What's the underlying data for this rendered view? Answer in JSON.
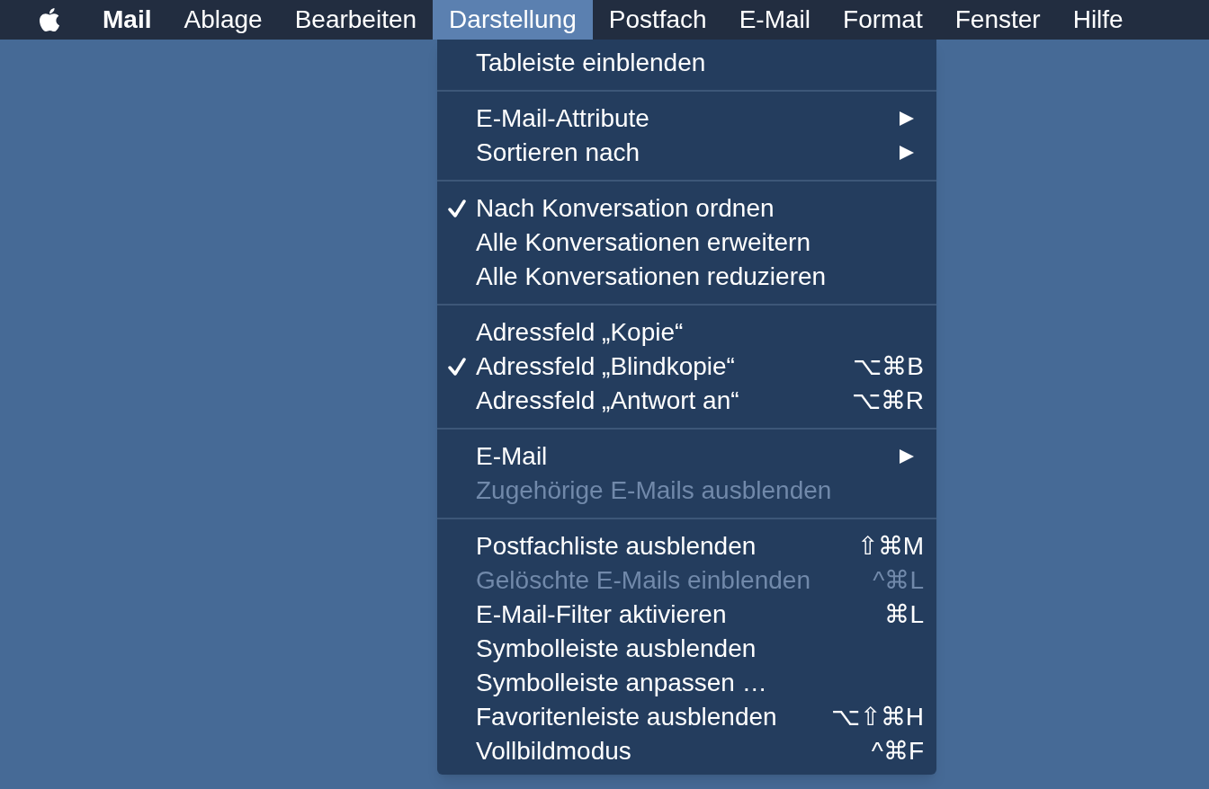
{
  "menu_bar": {
    "items": [
      {
        "label": "Mail",
        "bold": true,
        "selected": false
      },
      {
        "label": "Ablage",
        "bold": false,
        "selected": false
      },
      {
        "label": "Bearbeiten",
        "bold": false,
        "selected": false
      },
      {
        "label": "Darstellung",
        "bold": false,
        "selected": true
      },
      {
        "label": "Postfach",
        "bold": false,
        "selected": false
      },
      {
        "label": "E-Mail",
        "bold": false,
        "selected": false
      },
      {
        "label": "Format",
        "bold": false,
        "selected": false
      },
      {
        "label": "Fenster",
        "bold": false,
        "selected": false
      },
      {
        "label": "Hilfe",
        "bold": false,
        "selected": false
      }
    ]
  },
  "menu": {
    "groups": [
      [
        {
          "label": "Tableiste einblenden",
          "checked": false,
          "disabled": false,
          "submenu": false
        }
      ],
      [
        {
          "label": "E-Mail-Attribute",
          "checked": false,
          "disabled": false,
          "submenu": true
        },
        {
          "label": "Sortieren nach",
          "checked": false,
          "disabled": false,
          "submenu": true
        }
      ],
      [
        {
          "label": "Nach Konversation ordnen",
          "checked": true,
          "disabled": false,
          "submenu": false
        },
        {
          "label": "Alle Konversationen erweitern",
          "checked": false,
          "disabled": false,
          "submenu": false
        },
        {
          "label": "Alle Konversationen reduzieren",
          "checked": false,
          "disabled": false,
          "submenu": false
        }
      ],
      [
        {
          "label": "Adressfeld „Kopie“",
          "checked": false,
          "disabled": false,
          "submenu": false
        },
        {
          "label": "Adressfeld „Blindkopie“",
          "checked": true,
          "disabled": false,
          "submenu": false,
          "shortcut": "⌥⌘B"
        },
        {
          "label": "Adressfeld „Antwort an“",
          "checked": false,
          "disabled": false,
          "submenu": false,
          "shortcut": "⌥⌘R"
        }
      ],
      [
        {
          "label": "E-Mail",
          "checked": false,
          "disabled": false,
          "submenu": true
        },
        {
          "label": "Zugehörige E-Mails ausblenden",
          "checked": false,
          "disabled": true,
          "submenu": false
        }
      ],
      [
        {
          "label": "Postfachliste ausblenden",
          "checked": false,
          "disabled": false,
          "submenu": false,
          "shortcut": "⇧⌘M"
        },
        {
          "label": "Gelöschte E-Mails einblenden",
          "checked": false,
          "disabled": true,
          "submenu": false,
          "shortcut": "^⌘L"
        },
        {
          "label": "E-Mail-Filter aktivieren",
          "checked": false,
          "disabled": false,
          "submenu": false,
          "shortcut": "⌘L"
        },
        {
          "label": "Symbolleiste ausblenden",
          "checked": false,
          "disabled": false,
          "submenu": false
        },
        {
          "label": "Symbolleiste anpassen …",
          "checked": false,
          "disabled": false,
          "submenu": false
        },
        {
          "label": "Favoritenleiste ausblenden",
          "checked": false,
          "disabled": false,
          "submenu": false,
          "shortcut": "⌥⇧⌘H"
        },
        {
          "label": "Vollbildmodus",
          "checked": false,
          "disabled": false,
          "submenu": false,
          "shortcut": "^⌘F"
        }
      ]
    ]
  }
}
